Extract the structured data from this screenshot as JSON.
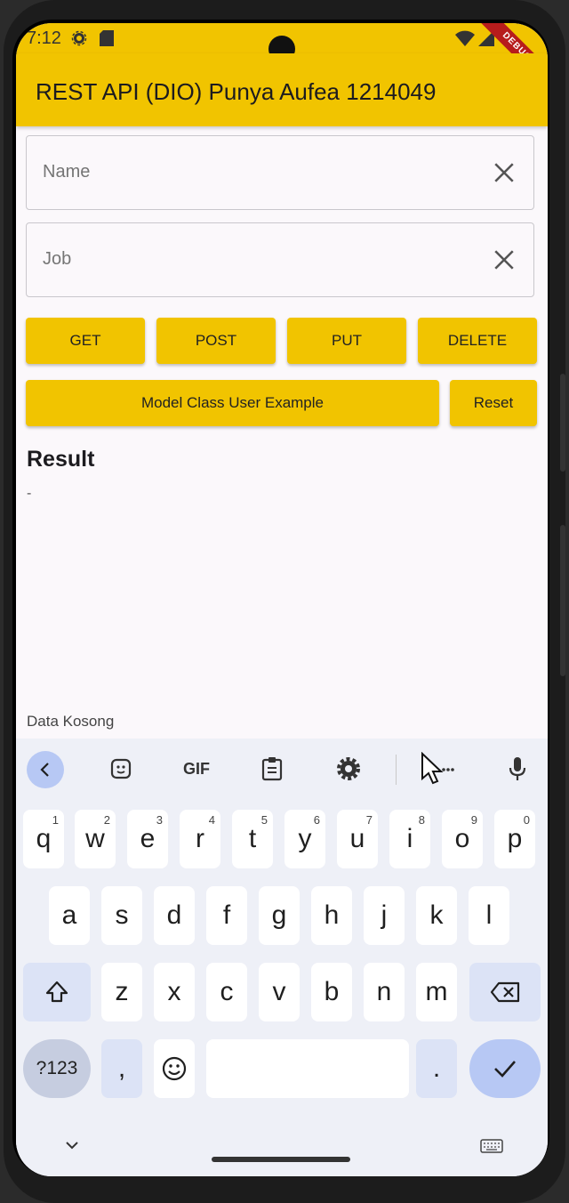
{
  "status": {
    "time": "7:12",
    "debug_label": "DEBUG"
  },
  "appbar": {
    "title": "REST API (DIO) Punya Aufea 1214049"
  },
  "form": {
    "name_placeholder": "Name",
    "job_placeholder": "Job"
  },
  "buttons": {
    "get": "GET",
    "post": "POST",
    "put": "PUT",
    "delete": "DELETE",
    "model_example": "Model Class User Example",
    "reset": "Reset"
  },
  "result": {
    "heading": "Result",
    "value": "-",
    "empty_message": "Data Kosong"
  },
  "keyboard": {
    "toolbar": [
      "back-icon",
      "sticker-icon",
      "GIF",
      "clipboard-icon",
      "gear-icon",
      "cursor-more-icon",
      "mic-icon"
    ],
    "row1": [
      {
        "k": "q",
        "n": "1"
      },
      {
        "k": "w",
        "n": "2"
      },
      {
        "k": "e",
        "n": "3"
      },
      {
        "k": "r",
        "n": "4"
      },
      {
        "k": "t",
        "n": "5"
      },
      {
        "k": "y",
        "n": "6"
      },
      {
        "k": "u",
        "n": "7"
      },
      {
        "k": "i",
        "n": "8"
      },
      {
        "k": "o",
        "n": "9"
      },
      {
        "k": "p",
        "n": "0"
      }
    ],
    "row2": [
      "a",
      "s",
      "d",
      "f",
      "g",
      "h",
      "j",
      "k",
      "l"
    ],
    "row3": [
      "z",
      "x",
      "c",
      "v",
      "b",
      "n",
      "m"
    ],
    "symbols_label": "?123",
    "comma": ",",
    "period": "."
  },
  "colors": {
    "accent": "#f1c400",
    "background": "#fbf8fb",
    "keyboard_bg": "#eef0f7"
  }
}
